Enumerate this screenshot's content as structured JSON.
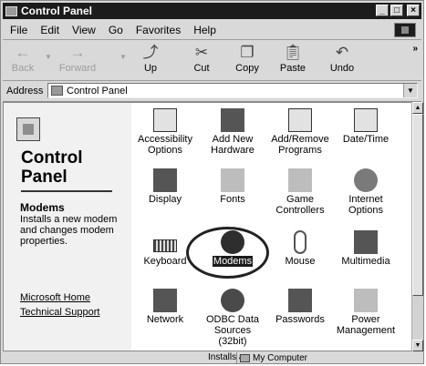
{
  "window": {
    "title": "Control Panel"
  },
  "menu": [
    "File",
    "Edit",
    "View",
    "Go",
    "Favorites",
    "Help"
  ],
  "toolbar": {
    "back": "Back",
    "forward": "Forward",
    "up": "Up",
    "cut": "Cut",
    "copy": "Copy",
    "paste": "Paste",
    "undo": "Undo"
  },
  "address": {
    "label": "Address",
    "value": "Control Panel"
  },
  "left_panel": {
    "title_line1": "Control",
    "title_line2": "Panel",
    "selected_name": "Modems",
    "selected_desc": "Installs a new modem and changes modem properties.",
    "links": [
      "Microsoft Home",
      "Technical Support"
    ]
  },
  "items": [
    {
      "label": "Accessibility Options",
      "icon": "accessibility-icon"
    },
    {
      "label": "Add New Hardware",
      "icon": "add-hardware-icon"
    },
    {
      "label": "Add/Remove Programs",
      "icon": "add-remove-programs-icon"
    },
    {
      "label": "Date/Time",
      "icon": "calendar-icon"
    },
    {
      "label": "Display",
      "icon": "display-icon"
    },
    {
      "label": "Fonts",
      "icon": "fonts-folder-icon"
    },
    {
      "label": "Game Controllers",
      "icon": "joystick-icon"
    },
    {
      "label": "Internet Options",
      "icon": "globe-icon"
    },
    {
      "label": "Keyboard",
      "icon": "keyboard-icon"
    },
    {
      "label": "Modems",
      "icon": "telephone-icon"
    },
    {
      "label": "Mouse",
      "icon": "mouse-icon"
    },
    {
      "label": "Multimedia",
      "icon": "multimedia-icon"
    },
    {
      "label": "Network",
      "icon": "network-icon"
    },
    {
      "label": "ODBC Data Sources (32bit)",
      "icon": "odbc-icon"
    },
    {
      "label": "Passwords",
      "icon": "keys-icon"
    },
    {
      "label": "Power Management",
      "icon": "power-plug-icon"
    }
  ],
  "status": {
    "text": "Installs a",
    "zone": "My Computer"
  }
}
